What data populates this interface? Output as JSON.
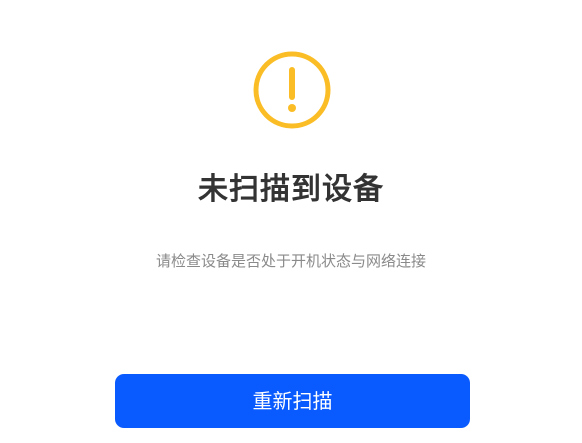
{
  "status": {
    "icon": "warning-circle-icon",
    "icon_color": "#fbbd26",
    "title": "未扫描到设备",
    "message": "请检查设备是否处于开机状态与网络连接"
  },
  "actions": {
    "rescan_label": "重新扫描",
    "accent_color": "#0a5bff"
  }
}
